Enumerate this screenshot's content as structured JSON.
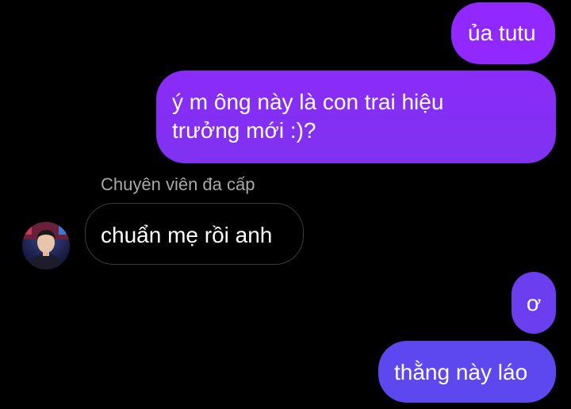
{
  "messages": {
    "m1": {
      "text": "ủa tutu"
    },
    "m2": {
      "line1": "ý m ông này là con trai hiệu",
      "line2": "trưởng mới :)?"
    },
    "m3": {
      "sender": "Chuyên viên đa cấp",
      "text": "chuẩn mẹ rồi anh"
    },
    "m4": {
      "text": "ơ"
    },
    "m5": {
      "text": "thằng này láo"
    }
  },
  "colors": {
    "background": "#000000",
    "outgoing_top": "#9028ff",
    "outgoing_bottom": "#5c48ee",
    "incoming_border": "#3a3a3a",
    "sender_text": "#a8a8a8"
  }
}
